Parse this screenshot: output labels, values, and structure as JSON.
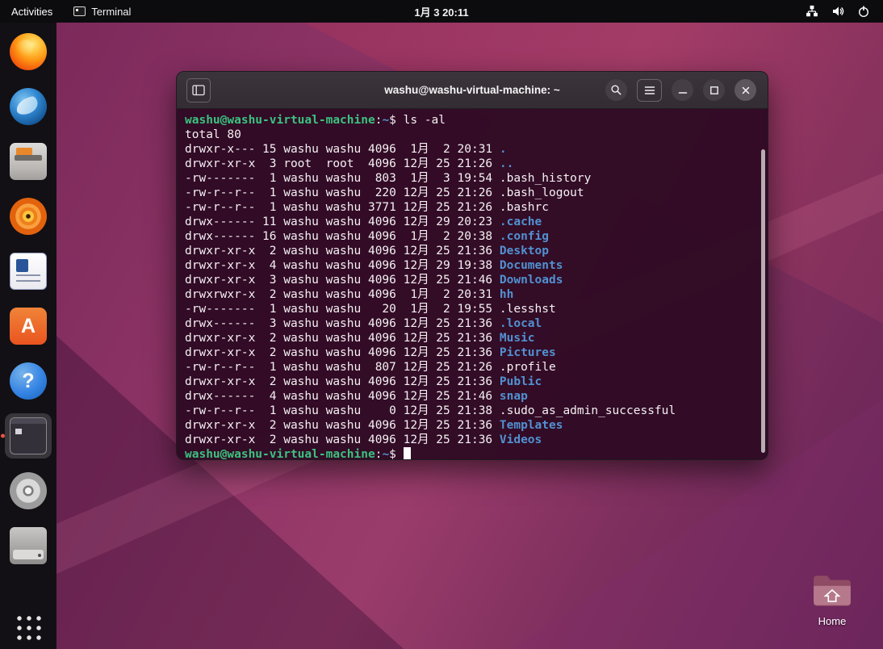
{
  "topbar": {
    "activities_label": "Activities",
    "focused_app_label": "Terminal",
    "clock": "1月 3 20:11",
    "status_icons": [
      "network-icon",
      "volume-icon",
      "power-icon"
    ]
  },
  "dock": {
    "items": [
      {
        "id": "firefox",
        "icon": "firefox-icon"
      },
      {
        "id": "thunderbird",
        "icon": "thunderbird-icon"
      },
      {
        "id": "files",
        "icon": "files-icon"
      },
      {
        "id": "rhythmbox",
        "icon": "rhythmbox-icon"
      },
      {
        "id": "writer",
        "icon": "libreoffice-writer-icon"
      },
      {
        "id": "software",
        "icon": "ubuntu-software-icon",
        "glyph": "A"
      },
      {
        "id": "help",
        "icon": "help-icon",
        "glyph": "?"
      },
      {
        "id": "terminal",
        "icon": "terminal-icon",
        "running": true,
        "active": true
      },
      {
        "id": "disc",
        "icon": "optical-disc-icon"
      },
      {
        "id": "drive",
        "icon": "removable-drive-icon"
      }
    ]
  },
  "terminal": {
    "title": "washu@washu-virtual-machine: ~",
    "colors": {
      "background": "#300a24",
      "foreground": "#f4f1f3",
      "prompt_green": "#3bc27f",
      "directory_blue": "#5191d1"
    },
    "lines": [
      [
        [
          "green",
          "washu@washu-virtual-machine"
        ],
        [
          "fg",
          ":"
        ],
        [
          "blue",
          "~"
        ],
        [
          "fg",
          "$ ls -al"
        ]
      ],
      [
        [
          "fg",
          "total 80"
        ]
      ],
      [
        [
          "fg",
          "drwxr-x--- 15 washu washu 4096  1月  2 20:31 "
        ],
        [
          "blue",
          "."
        ]
      ],
      [
        [
          "fg",
          "drwxr-xr-x  3 root  root  4096 12月 25 21:26 "
        ],
        [
          "blue",
          ".."
        ]
      ],
      [
        [
          "fg",
          "-rw-------  1 washu washu  803  1月  3 19:54 .bash_history"
        ]
      ],
      [
        [
          "fg",
          "-rw-r--r--  1 washu washu  220 12月 25 21:26 .bash_logout"
        ]
      ],
      [
        [
          "fg",
          "-rw-r--r--  1 washu washu 3771 12月 25 21:26 .bashrc"
        ]
      ],
      [
        [
          "fg",
          "drwx------ 11 washu washu 4096 12月 29 20:23 "
        ],
        [
          "blue",
          ".cache"
        ]
      ],
      [
        [
          "fg",
          "drwx------ 16 washu washu 4096  1月  2 20:38 "
        ],
        [
          "blue",
          ".config"
        ]
      ],
      [
        [
          "fg",
          "drwxr-xr-x  2 washu washu 4096 12月 25 21:36 "
        ],
        [
          "blue",
          "Desktop"
        ]
      ],
      [
        [
          "fg",
          "drwxr-xr-x  4 washu washu 4096 12月 29 19:38 "
        ],
        [
          "blue",
          "Documents"
        ]
      ],
      [
        [
          "fg",
          "drwxr-xr-x  3 washu washu 4096 12月 25 21:46 "
        ],
        [
          "blue",
          "Downloads"
        ]
      ],
      [
        [
          "fg",
          "drwxrwxr-x  2 washu washu 4096  1月  2 20:31 "
        ],
        [
          "blue",
          "hh"
        ]
      ],
      [
        [
          "fg",
          "-rw-------  1 washu washu   20  1月  2 19:55 .lesshst"
        ]
      ],
      [
        [
          "fg",
          "drwx------  3 washu washu 4096 12月 25 21:36 "
        ],
        [
          "blue",
          ".local"
        ]
      ],
      [
        [
          "fg",
          "drwxr-xr-x  2 washu washu 4096 12月 25 21:36 "
        ],
        [
          "blue",
          "Music"
        ]
      ],
      [
        [
          "fg",
          "drwxr-xr-x  2 washu washu 4096 12月 25 21:36 "
        ],
        [
          "blue",
          "Pictures"
        ]
      ],
      [
        [
          "fg",
          "-rw-r--r--  1 washu washu  807 12月 25 21:26 .profile"
        ]
      ],
      [
        [
          "fg",
          "drwxr-xr-x  2 washu washu 4096 12月 25 21:36 "
        ],
        [
          "blue",
          "Public"
        ]
      ],
      [
        [
          "fg",
          "drwx------  4 washu washu 4096 12月 25 21:46 "
        ],
        [
          "blue",
          "snap"
        ]
      ],
      [
        [
          "fg",
          "-rw-r--r--  1 washu washu    0 12月 25 21:38 .sudo_as_admin_successful"
        ]
      ],
      [
        [
          "fg",
          "drwxr-xr-x  2 washu washu 4096 12月 25 21:36 "
        ],
        [
          "blue",
          "Templates"
        ]
      ],
      [
        [
          "fg",
          "drwxr-xr-x  2 washu washu 4096 12月 25 21:36 "
        ],
        [
          "blue",
          "Videos"
        ]
      ],
      [
        [
          "green",
          "washu@washu-virtual-machine"
        ],
        [
          "fg",
          ":"
        ],
        [
          "blue",
          "~"
        ],
        [
          "fg",
          "$ "
        ],
        [
          "cursor",
          ""
        ]
      ]
    ]
  },
  "desktop": {
    "home_label": "Home"
  }
}
